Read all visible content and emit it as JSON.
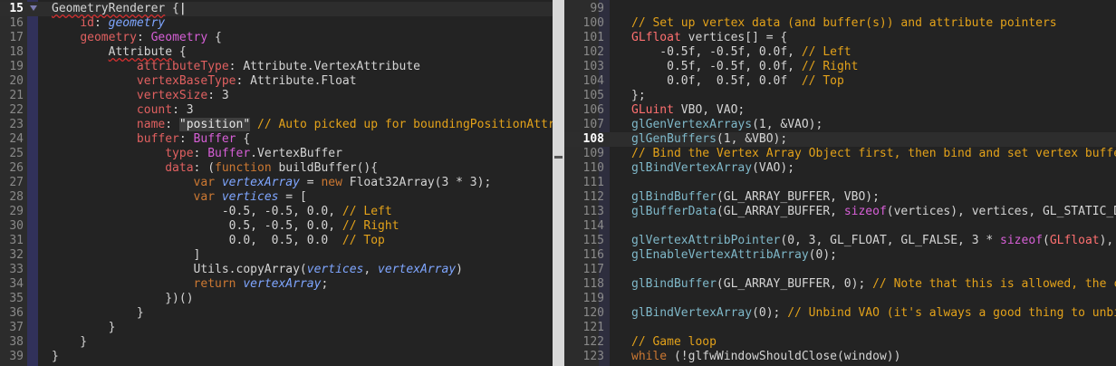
{
  "left_editor": {
    "first_line": 15,
    "lines": [
      {
        "n": "15",
        "active": true,
        "tokens": [
          [
            "GeometryRenderer",
            "plain ul"
          ],
          [
            " {",
            ""
          ],
          [
            "|",
            "cursor"
          ]
        ]
      },
      {
        "n": "16",
        "tokens": [
          [
            "    ",
            ""
          ],
          [
            "id",
            "prop"
          ],
          [
            ": ",
            ""
          ],
          [
            "geometry",
            "italic"
          ]
        ]
      },
      {
        "n": "17",
        "tokens": [
          [
            "    ",
            ""
          ],
          [
            "geometry",
            "prop"
          ],
          [
            ": ",
            ""
          ],
          [
            "Geometry",
            "type"
          ],
          [
            " {",
            ""
          ]
        ]
      },
      {
        "n": "18",
        "tokens": [
          [
            "        ",
            ""
          ],
          [
            "Attribute",
            "plain ul"
          ],
          [
            " {",
            ""
          ]
        ]
      },
      {
        "n": "19",
        "tokens": [
          [
            "            ",
            ""
          ],
          [
            "attributeType",
            "prop"
          ],
          [
            ": Attribute.VertexAttribute",
            ""
          ]
        ]
      },
      {
        "n": "20",
        "tokens": [
          [
            "            ",
            ""
          ],
          [
            "vertexBaseType",
            "prop"
          ],
          [
            ": Attribute.Float",
            ""
          ]
        ]
      },
      {
        "n": "21",
        "tokens": [
          [
            "            ",
            ""
          ],
          [
            "vertexSize",
            "prop"
          ],
          [
            ": 3",
            ""
          ]
        ]
      },
      {
        "n": "22",
        "tokens": [
          [
            "            ",
            ""
          ],
          [
            "count",
            "prop"
          ],
          [
            ": 3",
            ""
          ]
        ]
      },
      {
        "n": "23",
        "tokens": [
          [
            "            ",
            ""
          ],
          [
            "name",
            "prop"
          ],
          [
            ": ",
            ""
          ],
          [
            "\"position\"",
            "str"
          ],
          [
            " // Auto picked up for boundingPositionAttr",
            "com"
          ]
        ]
      },
      {
        "n": "24",
        "tokens": [
          [
            "            ",
            ""
          ],
          [
            "buffer",
            "prop"
          ],
          [
            ": ",
            ""
          ],
          [
            "Buffer",
            "type"
          ],
          [
            " {",
            ""
          ]
        ]
      },
      {
        "n": "25",
        "tokens": [
          [
            "                ",
            ""
          ],
          [
            "type",
            "prop"
          ],
          [
            ": ",
            ""
          ],
          [
            "Buffer",
            "type"
          ],
          [
            ".VertexBuffer",
            ""
          ]
        ]
      },
      {
        "n": "26",
        "tokens": [
          [
            "                ",
            ""
          ],
          [
            "data",
            "prop"
          ],
          [
            ": (",
            ""
          ],
          [
            "function",
            "kw"
          ],
          [
            " buildBuffer(){",
            ""
          ]
        ]
      },
      {
        "n": "27",
        "tokens": [
          [
            "                    ",
            ""
          ],
          [
            "var",
            "kw"
          ],
          [
            " ",
            ""
          ],
          [
            "vertexArray",
            "var"
          ],
          [
            " = ",
            ""
          ],
          [
            "new",
            "kw"
          ],
          [
            " Float32Array(3 * 3);",
            ""
          ]
        ]
      },
      {
        "n": "28",
        "tokens": [
          [
            "                    ",
            ""
          ],
          [
            "var",
            "kw"
          ],
          [
            " ",
            ""
          ],
          [
            "vertices",
            "var"
          ],
          [
            " = [",
            ""
          ]
        ]
      },
      {
        "n": "29",
        "tokens": [
          [
            "                        -0.5, -0.5, 0.0, ",
            ""
          ],
          [
            "// Left",
            "com"
          ]
        ]
      },
      {
        "n": "30",
        "tokens": [
          [
            "                         0.5, -0.5, 0.0, ",
            ""
          ],
          [
            "// Right",
            "com"
          ]
        ]
      },
      {
        "n": "31",
        "tokens": [
          [
            "                         0.0,  0.5, 0.0  ",
            ""
          ],
          [
            "// Top",
            "com"
          ]
        ]
      },
      {
        "n": "32",
        "tokens": [
          [
            "                    ]",
            ""
          ]
        ]
      },
      {
        "n": "33",
        "tokens": [
          [
            "                    Utils.copyArray(",
            ""
          ],
          [
            "vertices",
            "var"
          ],
          [
            ", ",
            ""
          ],
          [
            "vertexArray",
            "var"
          ],
          [
            ")",
            ""
          ]
        ]
      },
      {
        "n": "34",
        "tokens": [
          [
            "                    ",
            ""
          ],
          [
            "return",
            "kw"
          ],
          [
            " ",
            ""
          ],
          [
            "vertexArray",
            "var"
          ],
          [
            ";",
            ""
          ]
        ]
      },
      {
        "n": "35",
        "tokens": [
          [
            "                })()",
            ""
          ]
        ]
      },
      {
        "n": "36",
        "tokens": [
          [
            "            }",
            ""
          ]
        ]
      },
      {
        "n": "37",
        "tokens": [
          [
            "        }",
            ""
          ]
        ]
      },
      {
        "n": "38",
        "tokens": [
          [
            "    }",
            ""
          ]
        ]
      },
      {
        "n": "39",
        "tokens": [
          [
            "}",
            ""
          ]
        ]
      }
    ]
  },
  "right_editor": {
    "lines": [
      {
        "n": "99",
        "tokens": []
      },
      {
        "n": "100",
        "tokens": [
          [
            "// Set up vertex data (and buffer(s)) and attribute pointers",
            "com"
          ]
        ]
      },
      {
        "n": "101",
        "tokens": [
          [
            "GLfloat",
            "cap"
          ],
          [
            " vertices[] = {",
            ""
          ]
        ]
      },
      {
        "n": "102",
        "tokens": [
          [
            "    -0.5f, -0.5f, 0.0f, ",
            ""
          ],
          [
            "// Left",
            "com"
          ]
        ]
      },
      {
        "n": "103",
        "tokens": [
          [
            "     0.5f, -0.5f, 0.0f, ",
            ""
          ],
          [
            "// Right",
            "com"
          ]
        ]
      },
      {
        "n": "104",
        "tokens": [
          [
            "     0.0f,  0.5f, 0.0f  ",
            ""
          ],
          [
            "// Top",
            "com"
          ]
        ]
      },
      {
        "n": "105",
        "tokens": [
          [
            "};",
            ""
          ]
        ]
      },
      {
        "n": "106",
        "tokens": [
          [
            "GLuint",
            "cap"
          ],
          [
            " VBO, VAO;",
            ""
          ]
        ]
      },
      {
        "n": "107",
        "tokens": [
          [
            "glGenVertexArrays",
            "fn"
          ],
          [
            "(1, &VAO);",
            ""
          ]
        ]
      },
      {
        "n": "108",
        "active": true,
        "tokens": [
          [
            "glGenBuffers",
            "fn"
          ],
          [
            "(1, &VBO);",
            ""
          ]
        ]
      },
      {
        "n": "109",
        "tokens": [
          [
            "// Bind the Vertex Array Object first, then bind and set vertex buffe",
            "com"
          ]
        ]
      },
      {
        "n": "110",
        "tokens": [
          [
            "glBindVertexArray",
            "fn"
          ],
          [
            "(VAO);",
            ""
          ]
        ]
      },
      {
        "n": "111",
        "tokens": []
      },
      {
        "n": "112",
        "tokens": [
          [
            "glBindBuffer",
            "fn"
          ],
          [
            "(GL_ARRAY_BUFFER, VBO);",
            ""
          ]
        ]
      },
      {
        "n": "113",
        "tokens": [
          [
            "glBufferData",
            "fn"
          ],
          [
            "(GL_ARRAY_BUFFER, ",
            ""
          ],
          [
            "sizeof",
            "type"
          ],
          [
            "(vertices), vertices, GL_STATIC_D",
            ""
          ]
        ]
      },
      {
        "n": "114",
        "tokens": []
      },
      {
        "n": "115",
        "tokens": [
          [
            "glVertexAttribPointer",
            "fn"
          ],
          [
            "(0, 3, GL_FLOAT, GL_FALSE, 3 * ",
            ""
          ],
          [
            "sizeof",
            "type"
          ],
          [
            "(",
            ""
          ],
          [
            "GLfloat",
            "cap"
          ],
          [
            "),",
            ""
          ]
        ]
      },
      {
        "n": "116",
        "tokens": [
          [
            "glEnableVertexAttribArray",
            "fn"
          ],
          [
            "(0);",
            ""
          ]
        ]
      },
      {
        "n": "117",
        "tokens": []
      },
      {
        "n": "118",
        "tokens": [
          [
            "glBindBuffer",
            "fn"
          ],
          [
            "(GL_ARRAY_BUFFER, 0); ",
            ""
          ],
          [
            "// Note that this is allowed, the c",
            "com"
          ]
        ]
      },
      {
        "n": "119",
        "tokens": []
      },
      {
        "n": "120",
        "tokens": [
          [
            "glBindVertexArray",
            "fn"
          ],
          [
            "(0); ",
            ""
          ],
          [
            "// Unbind VAO (it's always a good thing to unbi",
            "com"
          ]
        ]
      },
      {
        "n": "121",
        "tokens": []
      },
      {
        "n": "122",
        "tokens": [
          [
            "// Game loop",
            "com"
          ]
        ]
      },
      {
        "n": "123",
        "tokens": [
          [
            "while",
            "kw"
          ],
          [
            " (!glfwWindowShouldClose(window))",
            ""
          ]
        ]
      }
    ]
  },
  "colors": {
    "background": "#232323",
    "keyword": "#cc7832",
    "property": "#e06060",
    "type": "#d75fd7",
    "comment": "#e3a21a",
    "function": "#7fb8c9",
    "variable": "#7fa6ff"
  }
}
